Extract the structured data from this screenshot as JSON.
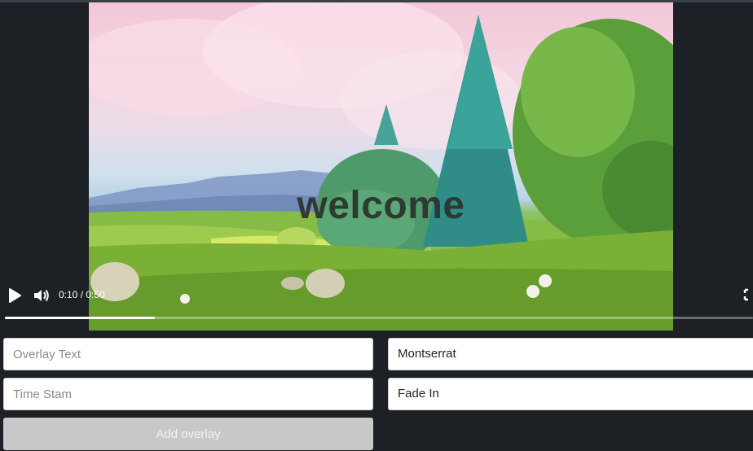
{
  "video": {
    "overlay_text": "welcome",
    "time_display": "0:10 / 0:50",
    "progress": 0.2
  },
  "form": {
    "overlay_text_placeholder": "Overlay Text",
    "timestamp_placeholder": "Time Stam",
    "font_value": "Montserrat",
    "animation_value": "Fade In",
    "add_label": "Add overlay"
  },
  "icons": {
    "play": "play-icon",
    "volume": "volume-icon",
    "fullscreen": "fullscreen-icon"
  }
}
